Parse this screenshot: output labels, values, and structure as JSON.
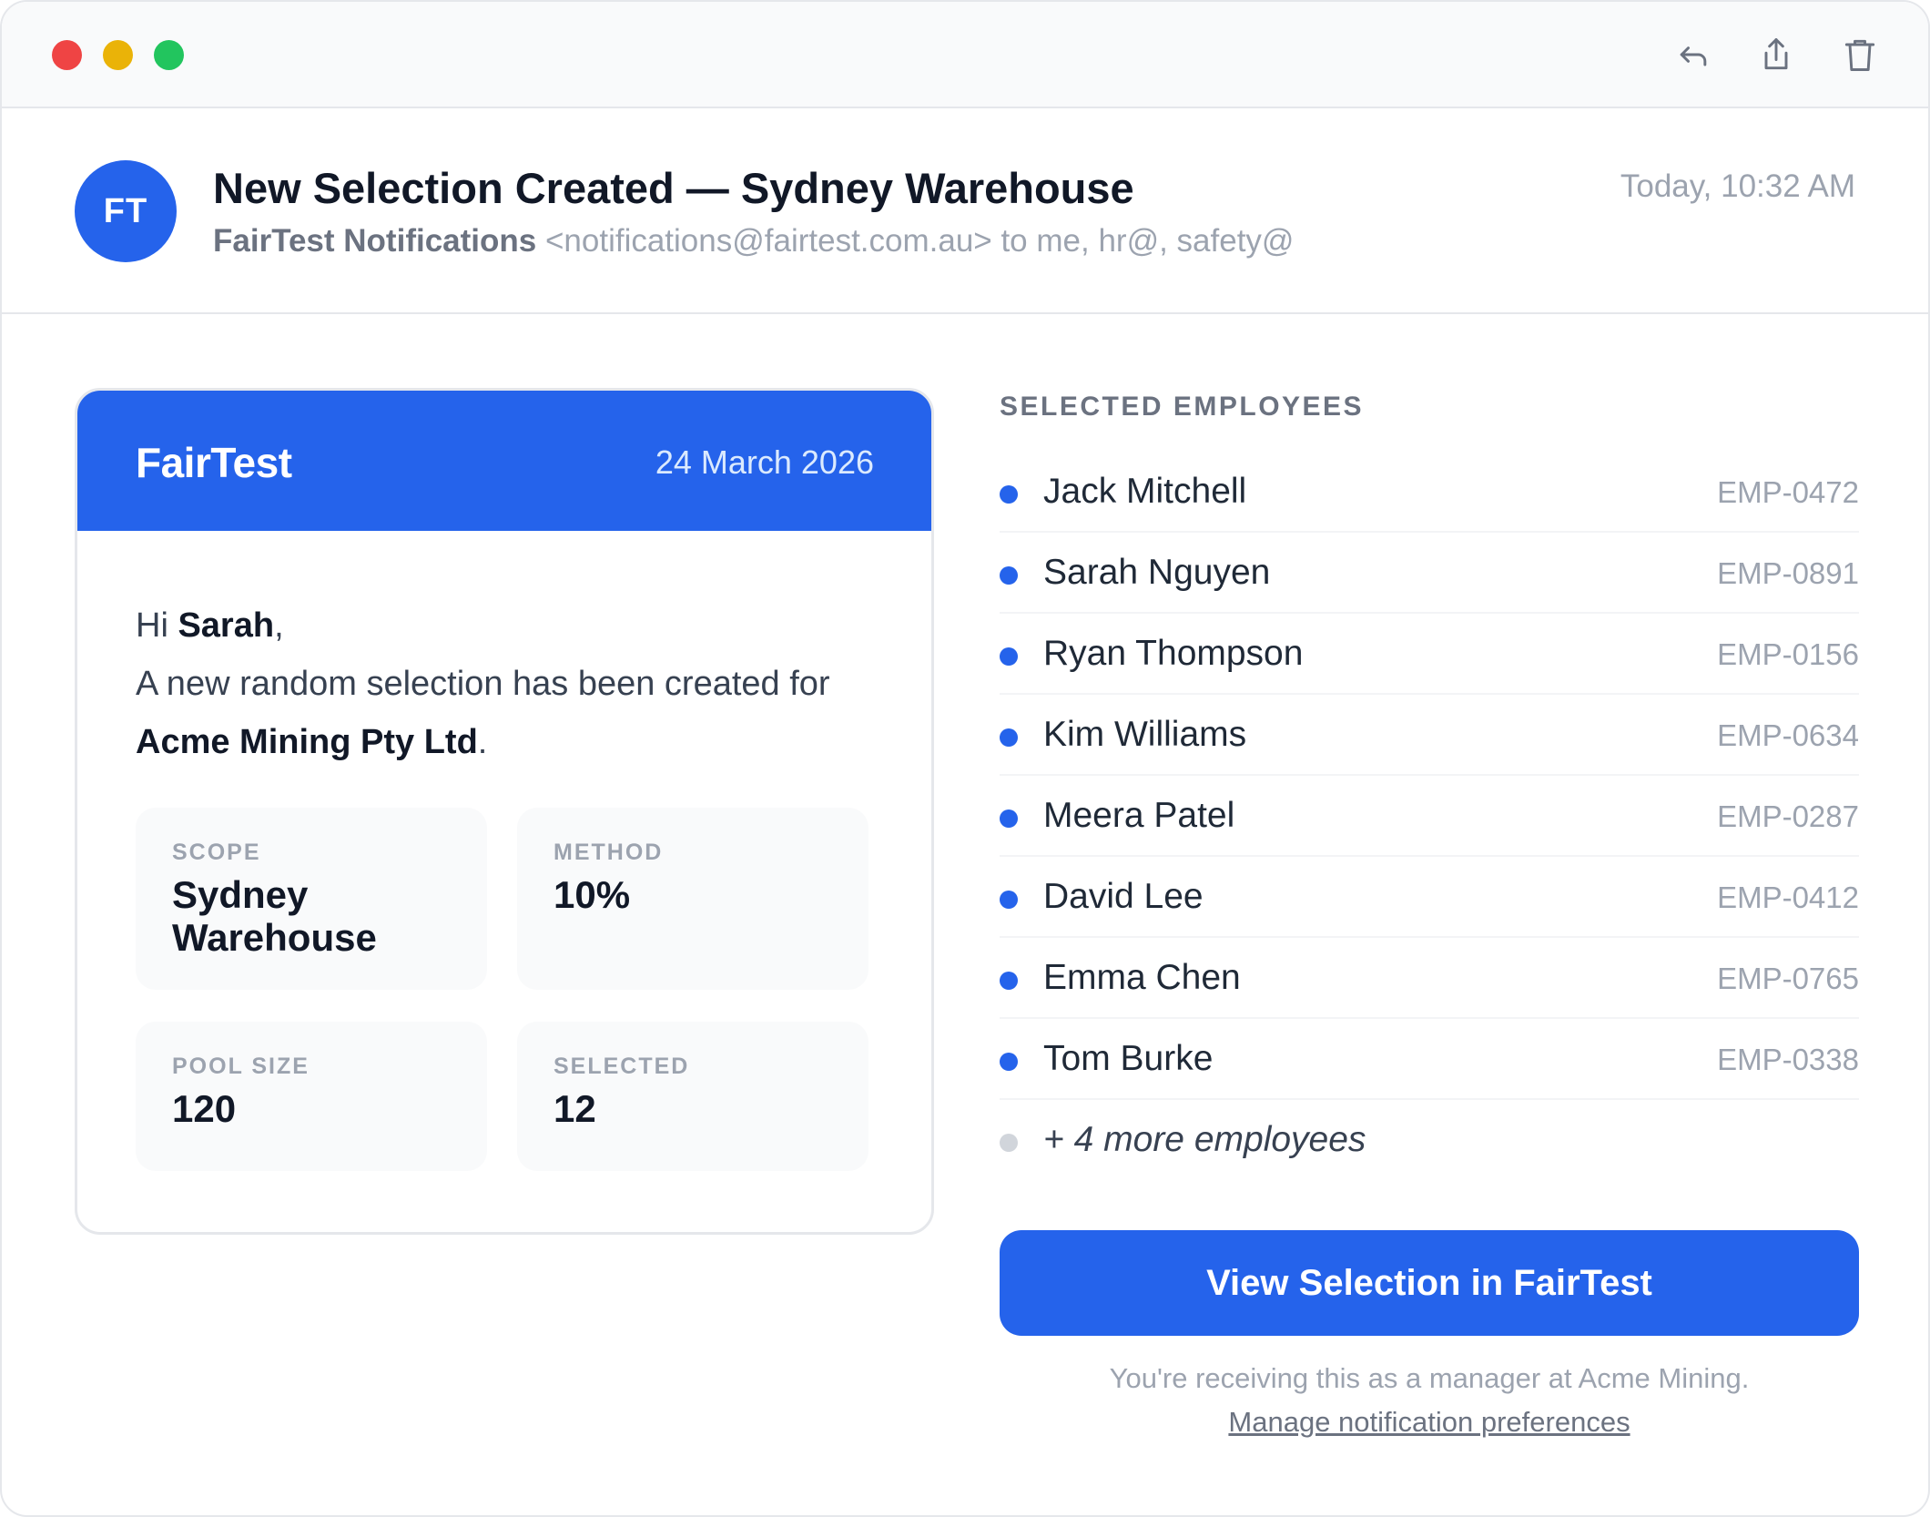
{
  "window": {
    "toolbar": {
      "reply_icon": "reply-icon",
      "share_icon": "share-icon",
      "trash_icon": "trash-icon"
    }
  },
  "email": {
    "avatar_initials": "FT",
    "subject": "New Selection Created — Sydney Warehouse",
    "sender_name": "FairTest Notifications",
    "sender_address": "<notifications@fairtest.com.au> to me, hr@, safety@",
    "timestamp": "Today, 10:32 AM"
  },
  "card": {
    "brand": "FairTest",
    "date": "24 March 2026",
    "greeting_prefix": "Hi ",
    "recipient": "Sarah",
    "greeting_suffix": ",",
    "message": "A new random selection has been created for ",
    "company": "Acme Mining Pty Ltd",
    "message_end": ".",
    "stats": {
      "scope": {
        "label": "SCOPE",
        "value": "Sydney Warehouse"
      },
      "method": {
        "label": "METHOD",
        "value": "10%"
      },
      "pool_size": {
        "label": "POOL SIZE",
        "value": "120"
      },
      "selected": {
        "label": "SELECTED",
        "value": "12"
      }
    }
  },
  "selected_employees": {
    "title": "SELECTED EMPLOYEES",
    "items": [
      {
        "name": "Jack Mitchell",
        "id": "EMP-0472"
      },
      {
        "name": "Sarah Nguyen",
        "id": "EMP-0891"
      },
      {
        "name": "Ryan Thompson",
        "id": "EMP-0156"
      },
      {
        "name": "Kim Williams",
        "id": "EMP-0634"
      },
      {
        "name": "Meera Patel",
        "id": "EMP-0287"
      },
      {
        "name": "David Lee",
        "id": "EMP-0412"
      },
      {
        "name": "Emma Chen",
        "id": "EMP-0765"
      },
      {
        "name": "Tom Burke",
        "id": "EMP-0338"
      }
    ],
    "more_label": "+ 4 more employees"
  },
  "cta": {
    "label": "View Selection in FairTest"
  },
  "footer": {
    "note": "You're receiving this as a manager at Acme Mining.",
    "link": "Manage notification preferences"
  },
  "colors": {
    "accent": "#2563eb",
    "close": "#ef4444",
    "minimize": "#eab308",
    "maximize": "#22c55e"
  }
}
